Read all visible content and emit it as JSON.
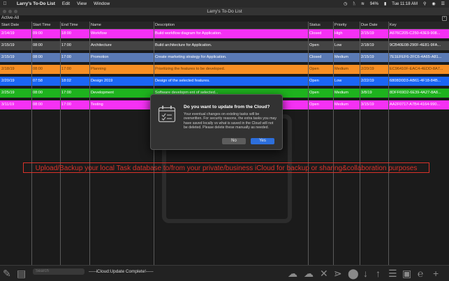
{
  "menubar": {
    "app_name": "Larry's To-Do List",
    "items": [
      "Edit",
      "View",
      "Window"
    ],
    "battery": "94%",
    "clock": "Tue 11:18 AM"
  },
  "window": {
    "title": "Larry's To-Do List",
    "filter_label": "Active-All",
    "collapse_symbol": "⌃"
  },
  "table": {
    "columns": [
      "Start Date",
      "Start Time",
      "End Time",
      "Name",
      "Description",
      "Status",
      "Priority",
      "Due Date",
      "Key"
    ],
    "rows": [
      {
        "color": "#f531f4",
        "cells": [
          "2/14/19",
          "09:00",
          "18:00",
          "Workflow",
          "Build workflow diagram for Application.",
          "Closed",
          "High",
          "2/15/19",
          "A676C205-C250-43E9-908..."
        ]
      },
      {
        "color": "#444444",
        "cells": [
          "2/15/19",
          "08:00",
          "17:00",
          "Architecture",
          "Build architecture for Application.",
          "Open",
          "Low",
          "2/18/19",
          "9CB40E08-290F-4E81-9FA..."
        ]
      },
      {
        "color": "#5a7ab5",
        "cells": [
          "2/15/19",
          "08:00",
          "17:00",
          "Promotion",
          "Create marketing strategy for Application.",
          "Closed",
          "Medium",
          "2/15/19",
          "7E1EFEF6-2FC6-4A65-A81..."
        ]
      },
      {
        "color": "#f78f24",
        "cells": [
          "2/18/19",
          "08:00",
          "17:00",
          "Planning",
          "Prioritizing the features to be developed.",
          "Open",
          "Medium",
          "2/20/19",
          "EC96410F-EAC4-4EDD-8A7..."
        ]
      },
      {
        "color": "#1a66f5",
        "cells": [
          "2/20/19",
          "07:58",
          "18:02",
          "Design 2019",
          "Design of the selected features.",
          "Open",
          "Low",
          "2/22/19",
          "6808D0D3-AB61-4F18-84B..."
        ]
      },
      {
        "color": "#1eb31e",
        "cells": [
          "2/25/19",
          "08:00",
          "17:00",
          "Development",
          "Software developm ent of selected...",
          "Open",
          "Medium",
          "3/8/19",
          "8DFF69D2-6E39-4A27-8A8..."
        ]
      },
      {
        "color": "#f531f4",
        "cells": [
          "3/11/19",
          "08:00",
          "17:00",
          "Testing",
          "",
          "Open",
          "Medium",
          "3/15/19",
          "AA2F0717-A7B4-4164-990..."
        ]
      }
    ]
  },
  "banner_text": "Upload/Backup your local Task database to/from your private/business iCloud for backup or sharing&collaboration purposes",
  "dialog": {
    "title": "Do you want to update from the Cloud?",
    "message": "Your eventual changes on existing tasks will be overwritten. For security reasons, the extra tasks you may have saved locally vs what is saved in the Cloud will not be deleted. Please delete these manually as needed.",
    "no_label": "No",
    "yes_label": "Yes"
  },
  "bottom": {
    "search_placeholder": "Search",
    "status_text": "-----iCloud:Update Complete!-----"
  },
  "icons": [
    "apple-icon",
    "wifi-icon",
    "bluetooth-icon",
    "battery-icon",
    "spotlight-icon",
    "siri-icon",
    "notification-center-icon",
    "calendar-icon",
    "edit-icon",
    "presentation-icon",
    "cloud-upload-icon",
    "cloud-download-icon",
    "delete-icon",
    "share-icon",
    "toggle-icon",
    "sort-down-icon",
    "sort-up-icon",
    "list-icon",
    "window-icon",
    "text-cursor-icon",
    "add-icon"
  ]
}
